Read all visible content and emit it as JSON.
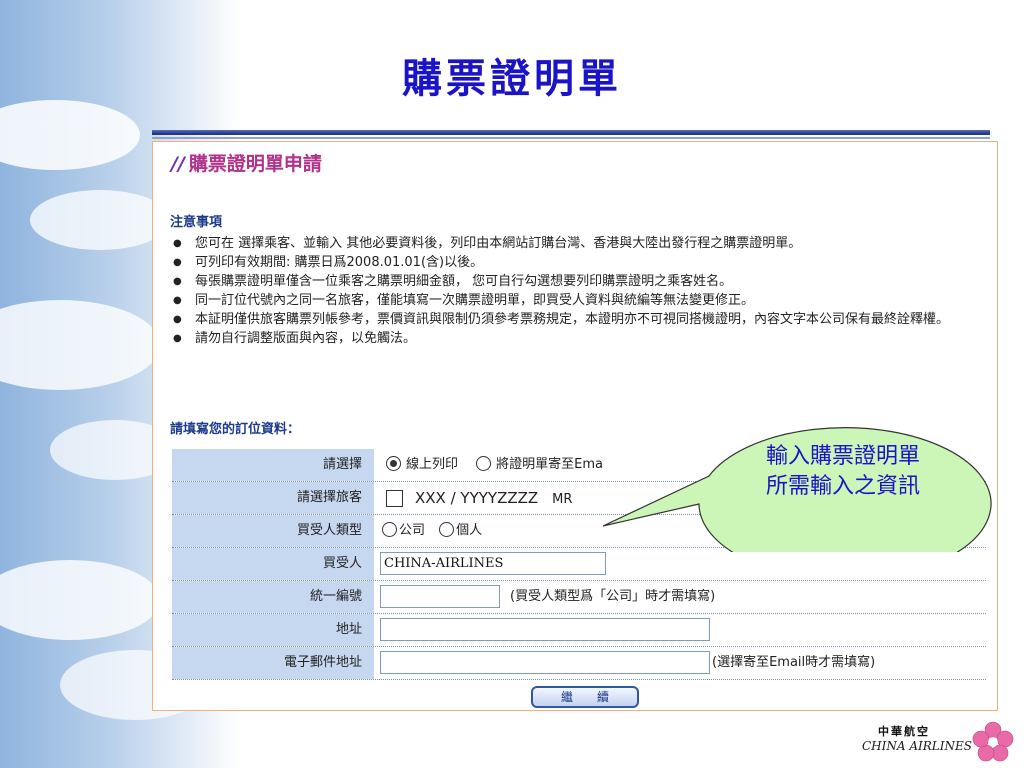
{
  "slide": {
    "title": "購票證明單"
  },
  "app": {
    "heading_slash": "//",
    "heading": "購票證明單申請"
  },
  "notice": {
    "title": "注意事項",
    "items": [
      "您可在 選擇乘客、並輸入 其他必要資料後，列印由本網站訂購台灣、香港與大陸出發行程之購票證明單。",
      "可列印有效期間: 購票日爲2008.01.01(含)以後。",
      "每張購票證明單僅含一位乘客之購票明細金額， 您可自行勾選想要列印購票證明之乘客姓名。",
      "同一訂位代號內之同一名旅客，僅能填寫一次購票證明單，即買受人資料與統編等無法變更修正。",
      "本証明僅供旅客購票列帳參考，票價資訊與限制仍須參考票務規定，本證明亦不可視同搭機證明，內容文字本公司保有最終詮釋權。",
      "請勿自行調整版面與內容，以免觸法。"
    ]
  },
  "form": {
    "title": "請填寫您的訂位資料：",
    "select_label": "請選擇",
    "option_print": "線上列印",
    "option_email": "將證明單寄至Ema",
    "passenger_label": "請選擇旅客",
    "passenger_name": "XXX / YYYYZZZZ",
    "passenger_title": "MR",
    "buyer_type_label": "買受人類型",
    "buyer_type_company": "公司",
    "buyer_type_individual": "個人",
    "buyer_label": "買受人",
    "buyer_value": "CHINA-AIRLINES",
    "tax_id_label": "統一編號",
    "tax_id_value": "",
    "tax_id_hint": "(買受人類型爲「公司」時才需填寫)",
    "address_label": "地址",
    "address_value": "",
    "email_label": "電子郵件地址",
    "email_value": "",
    "email_hint": "(選擇寄至Email時才需填寫)",
    "continue_label": "繼續"
  },
  "callout": {
    "line1": "輸入購票證明單",
    "line2": "所需輸入之資訊"
  },
  "logo": {
    "cn": "中華航空",
    "en": "CHINA AIRLINES"
  },
  "colors": {
    "title_blue": "#1a13c8",
    "label_bg": "#c6d8f0",
    "callout_fill": "#ccf5b8",
    "heading_magenta": "#b0328b",
    "panel_border": "#f3b07a"
  }
}
